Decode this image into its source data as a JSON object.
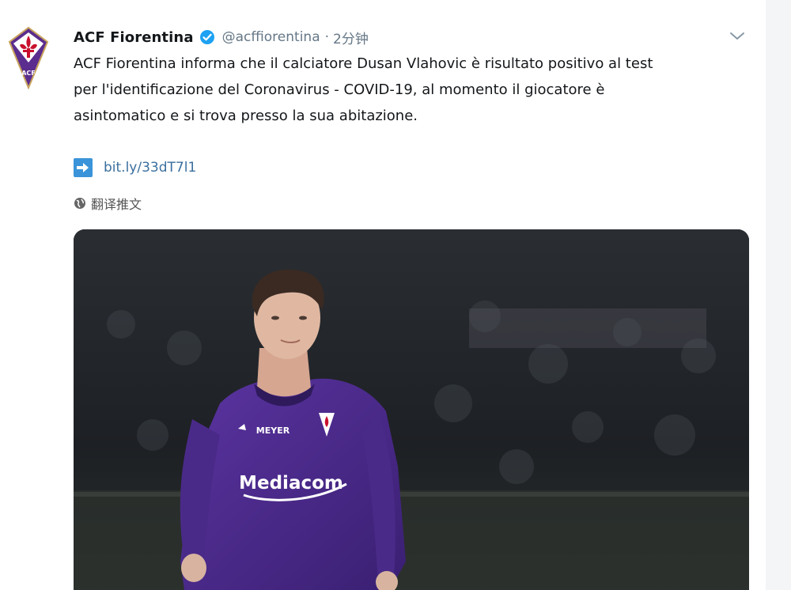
{
  "tweet": {
    "author_name": "ACF Fiorentina",
    "author_handle": "@acffiorentina",
    "separator": "·",
    "time": "2分钟",
    "text_lines": [
      "ACF Fiorentina informa che il calciatore Dusan Vlahovic è risultato positivo al test",
      "per l'identificazione del Coronavirus - COVID-19, al momento il giocatore è",
      "asintomatico e si trova presso la sua abitazione."
    ],
    "link": "bit.ly/33dT7l1",
    "translate_label": "翻译推文",
    "avatar_text": "ACF",
    "jersey_sponsor": "Mediacom",
    "jersey_brand": "MEYER"
  },
  "icons": {
    "verified": "verified-badge-icon",
    "chevron": "chevron-down-icon",
    "link": "arrow-right-icon",
    "globe": "globe-icon"
  },
  "colors": {
    "verified_blue": "#1da1f2",
    "link_blue": "#3b6f9e",
    "link_icon_bg": "#3b94d9",
    "handle_gray": "#657786",
    "jersey_purple": "#4b2a8a"
  }
}
